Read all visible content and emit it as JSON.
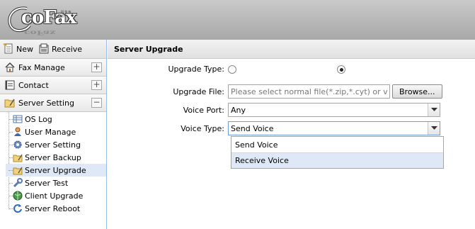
{
  "app": {
    "logo_text": "coFax",
    "logo_sub": "科 技 有 限"
  },
  "toolbar": {
    "new_label": "New",
    "receive_label": "Receive"
  },
  "sidebar": {
    "groups": [
      {
        "label": "Fax Manage",
        "toggle": "+"
      },
      {
        "label": "Contact",
        "toggle": "+"
      },
      {
        "label": "Server Setting",
        "toggle": "−"
      }
    ],
    "items": [
      {
        "label": "OS Log"
      },
      {
        "label": "User Manage"
      },
      {
        "label": "Server Setting"
      },
      {
        "label": "Server Backup"
      },
      {
        "label": "Server Upgrade",
        "active": true
      },
      {
        "label": "Server Test"
      },
      {
        "label": "Client Upgrade"
      },
      {
        "label": "Server Reboot"
      }
    ]
  },
  "main": {
    "title": "Server Upgrade",
    "form": {
      "upgrade_type_label": "Upgrade Type:",
      "upgrade_file_label": "Upgrade File:",
      "upgrade_file_placeholder": "Please select normal file(*.zip,*.cyt) or v",
      "browse_label": "Browse...",
      "voice_port_label": "Voice Port:",
      "voice_port_value": "Any",
      "voice_type_label": "Voice Type:",
      "voice_type_value": "Send Voice",
      "voice_type_options": [
        "Send Voice",
        "Receive Voice"
      ]
    }
  },
  "colors": {
    "accent": "#99bbe8",
    "highlight": "#dfe8f6"
  }
}
